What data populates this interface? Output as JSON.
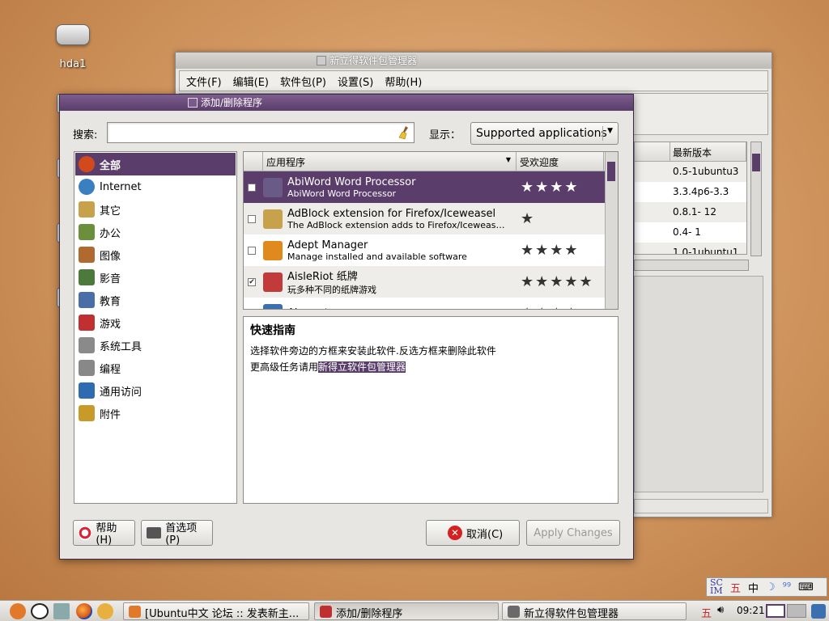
{
  "desktop": {
    "icon_label": "hda1"
  },
  "synaptic": {
    "title": "新立得软件包管理器",
    "menu": [
      "文件(F)",
      "编辑(E)",
      "软件包(P)",
      "设置(S)",
      "帮助(H)"
    ],
    "table_header": "最新版本",
    "versions": [
      "0.5-1ubuntu3",
      "3.3.4p6-3.3",
      "0.8.1- 12",
      "0.4- 1",
      "1.0-1ubuntu1"
    ]
  },
  "addremove": {
    "title": "添加/删除程序",
    "search_label": "搜索:",
    "search_value": "",
    "show_label": "显示：",
    "show_value": "Supported applications",
    "categories": [
      {
        "label": "全部",
        "icon": "ubuntu-logo-icon",
        "color": "#d24a1c"
      },
      {
        "label": "Internet",
        "icon": "globe-icon",
        "color": "#3a7fbf"
      },
      {
        "label": "其它",
        "icon": "package-icon",
        "color": "#c8a24a"
      },
      {
        "label": "办公",
        "icon": "books-icon",
        "color": "#6b8f3a"
      },
      {
        "label": "图像",
        "icon": "paintbrush-icon",
        "color": "#b0692f"
      },
      {
        "label": "影音",
        "icon": "film-icon",
        "color": "#4b7a3c"
      },
      {
        "label": "教育",
        "icon": "education-icon",
        "color": "#4a6fa8"
      },
      {
        "label": "游戏",
        "icon": "games-icon",
        "color": "#c03030"
      },
      {
        "label": "系统工具",
        "icon": "gear-icon",
        "color": "#8a8a8a"
      },
      {
        "label": "编程",
        "icon": "pen-icon",
        "color": "#888888"
      },
      {
        "label": "通用访问",
        "icon": "accessibility-icon",
        "color": "#2f6bb0"
      },
      {
        "label": "附件",
        "icon": "accessories-icon",
        "color": "#c79a2a"
      }
    ],
    "columns": {
      "app": "应用程序",
      "popularity": "受欢迎度"
    },
    "apps": [
      {
        "name": "AbiWord Word Processor",
        "desc": "AbiWord Word Processor",
        "checked": false,
        "stars": "★★★★",
        "popularity": 4,
        "icon": "abiword-icon",
        "color": "#6a5a88"
      },
      {
        "name": "AdBlock extension for Firefox/Iceweasel",
        "desc": "The AdBlock extension adds to Firefox/Iceweas…",
        "checked": false,
        "stars": "★",
        "popularity": 1,
        "icon": "package-icon",
        "color": "#c8a24a"
      },
      {
        "name": "Adept Manager",
        "desc": "Manage installed and available software",
        "checked": false,
        "stars": "★★★★",
        "popularity": 4,
        "icon": "adept-icon",
        "color": "#e08a1e"
      },
      {
        "name": "AisleRiot 纸牌",
        "desc": "玩多种不同的纸牌游戏",
        "checked": true,
        "stars": "★★★★★",
        "popularity": 5,
        "icon": "cards-icon",
        "color": "#c23a3a"
      },
      {
        "name": "Akregator",
        "desc": "",
        "checked": false,
        "stars": "★★★★",
        "popularity": 4,
        "icon": "feed-icon",
        "color": "#3a6fb0"
      }
    ],
    "guide": {
      "title": "快速指南",
      "line1": "选择软件旁边的方框来安装此软件.反选方框来删除此软件",
      "line2": "更高级任务请用",
      "link": "新得立软件包管理器"
    },
    "buttons": {
      "help": "帮助(H)",
      "preferences": "首选项(P)",
      "cancel": "取消(C)",
      "apply": "Apply Changes"
    }
  },
  "tray": [
    "五",
    "中",
    "☽",
    "⁹⁹"
  ],
  "taskbar": {
    "items": [
      "[Ubuntu中文 论坛 :: 发表新主...",
      "添加/删除程序",
      "新立得软件包管理器"
    ],
    "ime": "五",
    "clock": "09:21"
  }
}
